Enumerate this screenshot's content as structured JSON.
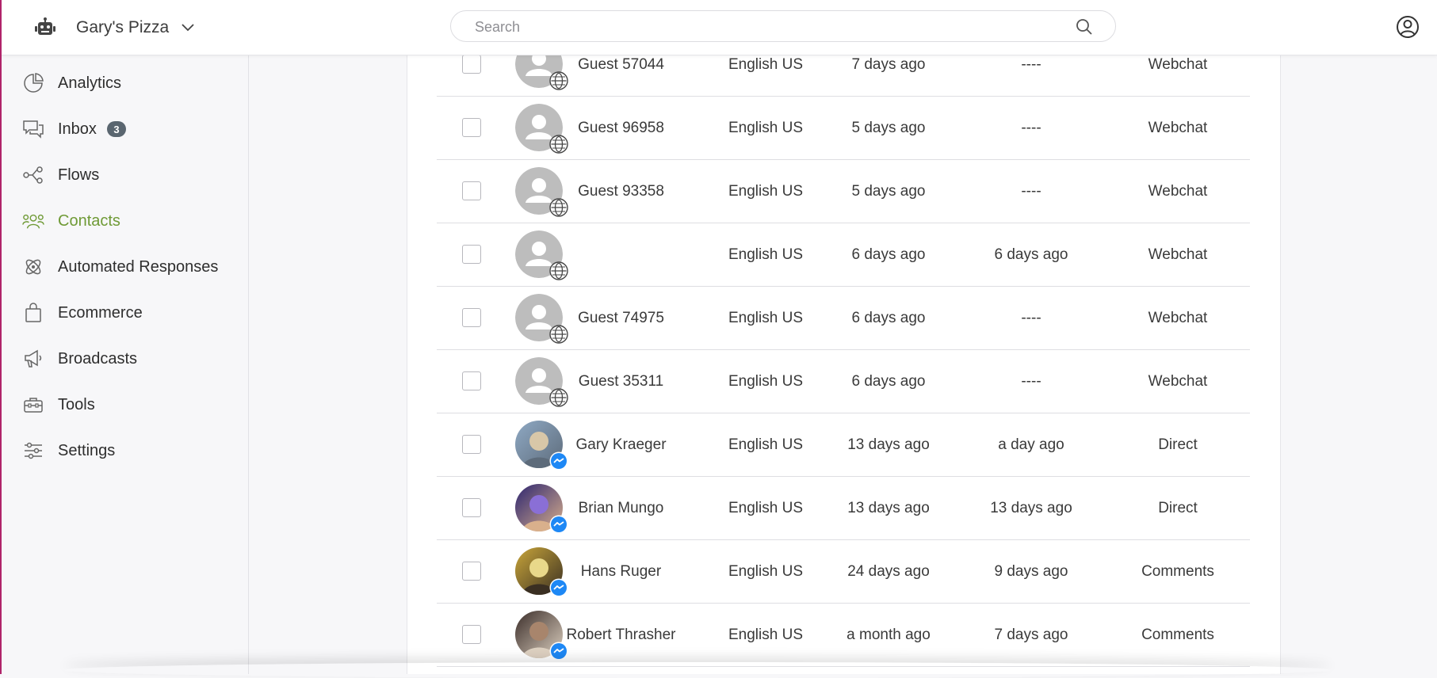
{
  "header": {
    "business_name": "Gary's Pizza",
    "search_placeholder": "Search"
  },
  "sidebar": {
    "items": [
      {
        "label": "Analytics",
        "icon": "analytics-icon"
      },
      {
        "label": "Inbox",
        "icon": "inbox-icon",
        "badge": "3"
      },
      {
        "label": "Flows",
        "icon": "flows-icon"
      },
      {
        "label": "Contacts",
        "icon": "contacts-icon",
        "active": true
      },
      {
        "label": "Automated Responses",
        "icon": "automated-responses-icon"
      },
      {
        "label": "Ecommerce",
        "icon": "shopping-bag-icon"
      },
      {
        "label": "Broadcasts",
        "icon": "megaphone-icon"
      },
      {
        "label": "Tools",
        "icon": "toolbox-icon"
      },
      {
        "label": "Settings",
        "icon": "sliders-icon"
      }
    ],
    "active_color": "#6f9a36"
  },
  "contacts": {
    "rows": [
      {
        "name": "Guest 57044",
        "language": "English US",
        "created": "7 days ago",
        "last_seen": "----",
        "source": "Webchat",
        "channel": "webchat",
        "avatar": "default"
      },
      {
        "name": "Guest 96958",
        "language": "English US",
        "created": "5 days ago",
        "last_seen": "----",
        "source": "Webchat",
        "channel": "webchat",
        "avatar": "default"
      },
      {
        "name": "Guest 93358",
        "language": "English US",
        "created": "5 days ago",
        "last_seen": "----",
        "source": "Webchat",
        "channel": "webchat",
        "avatar": "default"
      },
      {
        "name": "",
        "language": "English US",
        "created": "6 days ago",
        "last_seen": "6 days ago",
        "source": "Webchat",
        "channel": "webchat",
        "avatar": "default"
      },
      {
        "name": "Guest 74975",
        "language": "English US",
        "created": "6 days ago",
        "last_seen": "----",
        "source": "Webchat",
        "channel": "webchat",
        "avatar": "default"
      },
      {
        "name": "Guest 35311",
        "language": "English US",
        "created": "6 days ago",
        "last_seen": "----",
        "source": "Webchat",
        "channel": "webchat",
        "avatar": "default"
      },
      {
        "name": "Gary Kraeger",
        "language": "English US",
        "created": "13 days ago",
        "last_seen": "a day ago",
        "source": "Direct",
        "channel": "messenger",
        "avatar": "photo-1"
      },
      {
        "name": "Brian Mungo",
        "language": "English US",
        "created": "13 days ago",
        "last_seen": "13 days ago",
        "source": "Direct",
        "channel": "messenger",
        "avatar": "photo-2"
      },
      {
        "name": "Hans Ruger",
        "language": "English US",
        "created": "24 days ago",
        "last_seen": "9 days ago",
        "source": "Comments",
        "channel": "messenger",
        "avatar": "photo-3"
      },
      {
        "name": "Robert Thrasher",
        "language": "English US",
        "created": "a month ago",
        "last_seen": "7 days ago",
        "source": "Comments",
        "channel": "messenger",
        "avatar": "photo-4"
      }
    ]
  },
  "colors": {
    "messenger": "#1e88f5",
    "accent_edge": "#b0246a",
    "avatar_default": "#bdbdbd"
  }
}
